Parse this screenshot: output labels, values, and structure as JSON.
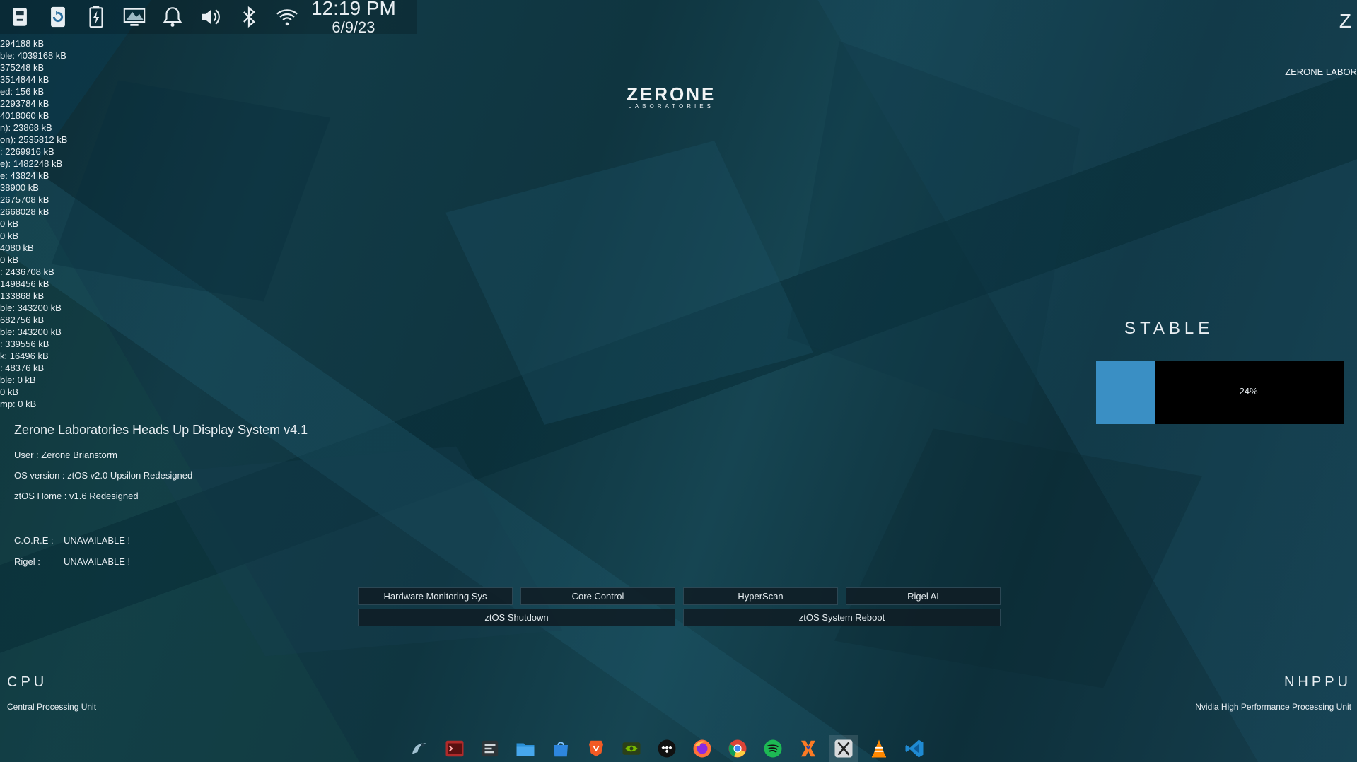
{
  "topbar": {
    "icons": [
      "usb-drive-icon",
      "refresh-device-icon",
      "battery-icon",
      "display-icon",
      "notification-bell-icon",
      "volume-icon",
      "bluetooth-icon",
      "wifi-icon"
    ],
    "time": "12:19 PM",
    "date": "6/9/23"
  },
  "corner_letter": "Z",
  "brand_right": "ZERONE LABOR",
  "memory_lines": [
    "294188 kB",
    "ble:   4039168 kB",
    "375248 kB",
    "3514844 kB",
    "ed:       156 kB",
    "2293784 kB",
    "4018060 kB",
    "n):     23868 kB",
    "on): 2535812 kB",
    ":   2269916 kB",
    "e): 1482248 kB",
    "e:     43824 kB",
    "38900 kB",
    "2675708 kB",
    "2668028 kB",
    "0 kB",
    "0 kB",
    "4080 kB",
    "0 kB",
    ":     2436708 kB",
    "1498456 kB",
    "133868 kB",
    "ble:   343200 kB",
    "682756 kB",
    "ble:   343200 kB",
    ":     339556 kB",
    "k:     16496 kB",
    ":       48376 kB",
    "ble:        0 kB",
    "0 kB",
    "mp:        0 kB"
  ],
  "logo": {
    "main": "ZERONE",
    "sub": "LABORATORIES"
  },
  "hud": {
    "title": "Zerone Laboratories Heads Up Display System v4.1",
    "user": "User : Zerone Brianstorm",
    "os_version": "OS version : ztOS v2.0 Upsilon Redesigned",
    "home": "ztOS Home : v1.6 Redesigned",
    "core_label": "C.O.R.E :",
    "core_value": "UNAVAILABLE !",
    "rigel_label": "Rigel :",
    "rigel_value": "UNAVAILABLE !"
  },
  "stable": {
    "label": "STABLE",
    "percent_text": "24%",
    "fraction": 0.24,
    "fill_color": "#3a8fc4"
  },
  "buttons": {
    "hardware": "Hardware Monitoring Sys",
    "core": "Core Control",
    "hyperscan": "HyperScan",
    "rigel": "Rigel AI",
    "shutdown": "ztOS Shutdown",
    "reboot": "ztOS System Reboot"
  },
  "cpu": {
    "title": "CPU",
    "subtitle": "Central Processing Unit"
  },
  "npu": {
    "title": "NHPPU",
    "subtitle": "Nvidia High Performance Processing Unit"
  },
  "dock": [
    "linux-logo-icon",
    "red-terminal-icon",
    "settings-panel-icon",
    "file-manager-icon",
    "software-store-icon",
    "brave-browser-icon",
    "nvidia-icon",
    "tidal-icon",
    "firefox-icon",
    "chrome-icon",
    "spotify-icon",
    "xampp-icon",
    "x-app-icon",
    "vlc-icon",
    "vscode-icon"
  ]
}
